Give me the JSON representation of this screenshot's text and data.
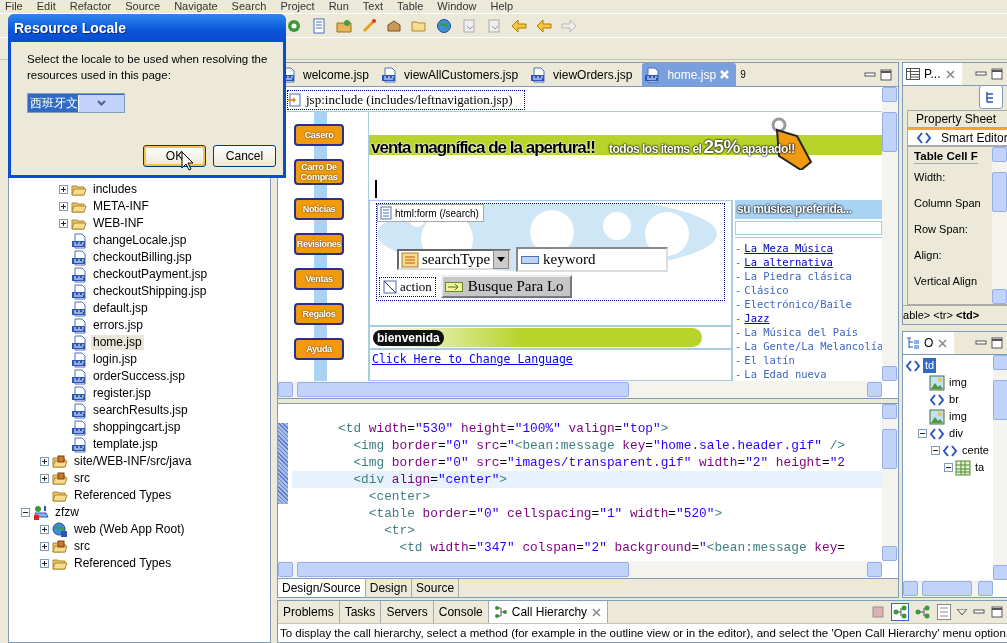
{
  "menu": [
    "File",
    "Edit",
    "Refactor",
    "Source",
    "Navigate",
    "Search",
    "Project",
    "Run",
    "Text",
    "Table",
    "Window",
    "Help"
  ],
  "dialog": {
    "title": "Resource Locale",
    "message": "Select the locale to be used when resolving the resources used in this page:",
    "locale": "西班牙文",
    "buttons": [
      {
        "label": "OK",
        "default": true
      },
      {
        "label": "Cancel",
        "default": false
      }
    ]
  },
  "explorer": {
    "tree": [
      {
        "children": [
          {
            "children": [
              {
                "label": "includes",
                "kind": "folder",
                "expanded": false,
                "selected": false
              },
              {
                "label": "META-INF",
                "kind": "folder",
                "expanded": false,
                "selected": false
              },
              {
                "label": "WEB-INF",
                "kind": "folder",
                "expanded": false,
                "selected": false
              },
              {
                "label": "changeLocale.jsp",
                "kind": "jsp",
                "selected": false
              },
              {
                "label": "checkoutBilling.jsp",
                "kind": "jsp",
                "selected": false
              },
              {
                "label": "checkoutPayment.jsp",
                "kind": "jsp",
                "selected": false
              },
              {
                "label": "checkoutShipping.jsp",
                "kind": "jsp",
                "selected": false
              },
              {
                "label": "default.jsp",
                "kind": "jsp",
                "selected": false
              },
              {
                "label": "errors.jsp",
                "kind": "jsp",
                "selected": false
              },
              {
                "label": "home.jsp",
                "kind": "jsp",
                "selected": true
              },
              {
                "label": "login.jsp",
                "kind": "jsp",
                "selected": false
              },
              {
                "label": "orderSuccess.jsp",
                "kind": "jsp",
                "selected": false
              },
              {
                "label": "register.jsp",
                "kind": "jsp",
                "selected": false
              },
              {
                "label": "searchResults.jsp",
                "kind": "jsp",
                "selected": false
              },
              {
                "label": "shoppingcart.jsp",
                "kind": "jsp",
                "selected": false
              },
              {
                "label": "template.jsp",
                "kind": "jsp",
                "selected": false
              }
            ]
          },
          {
            "label": "site/WEB-INF/src/java",
            "kind": "package",
            "expanded": false,
            "selected": false
          },
          {
            "label": "src",
            "kind": "package",
            "expanded": false,
            "selected": false
          },
          {
            "label": "Referenced Types",
            "kind": "folder",
            "selected": false
          }
        ]
      },
      {
        "label": "zfzw",
        "kind": "project",
        "expanded": true,
        "selected": false,
        "children": [
          {
            "label": "web (Web App Root)",
            "kind": "web",
            "expanded": false,
            "selected": false
          },
          {
            "label": "src",
            "kind": "package",
            "expanded": false,
            "selected": false
          },
          {
            "label": "Referenced Types",
            "kind": "folder",
            "expanded": false,
            "selected": false
          }
        ]
      }
    ]
  },
  "editor": {
    "tabs": [
      {
        "label": "welcome.jsp",
        "selected": false
      },
      {
        "label": "viewAllCustomers.jsp",
        "selected": false
      },
      {
        "label": "viewOrders.jsp",
        "selected": false
      },
      {
        "label": "home.jsp",
        "selected": true
      }
    ],
    "overflow_count": "9",
    "design": {
      "include_tag": "jsp:include (includes/leftnavigation.jsp)",
      "nav_buttons": [
        "Casero",
        "Carro De Compras",
        "Noticias",
        "Revisiones",
        "Ventas",
        "Regalos",
        "Ayuda"
      ],
      "banner": {
        "headline": "venta magnífica de la apertura!!",
        "promo": "todos los items el",
        "discount": "25%",
        "promo_end": "apagado!!"
      },
      "form": {
        "tag": "html:form (/search)",
        "select": "searchType",
        "input": "keyword",
        "action": "action",
        "submit": "Busque Para Lo"
      },
      "welcome": "bienvenida",
      "language_link": "Click Here to Change Language",
      "music": {
        "heading": "su música preferida...",
        "links": [
          {
            "bullet": "-",
            "label": "La Meza Música",
            "underlined": true
          },
          {
            "bullet": "-",
            "label": "La alternativa",
            "underlined": true
          },
          {
            "bullet": "-",
            "label": "La Piedra clásica",
            "underlined": false
          },
          {
            "bullet": "-",
            "label": "Clásico",
            "underlined": false
          },
          {
            "bullet": "-",
            "label": "Electrónico/Baile",
            "underlined": false
          },
          {
            "bullet": "-",
            "label": "Jazz",
            "underlined": true
          },
          {
            "bullet": "-",
            "label": "La Música del País",
            "underlined": false
          },
          {
            "bullet": "-",
            "label": "La Gente/La Melancolía",
            "underlined": false
          },
          {
            "bullet": "-",
            "label": "El latín",
            "underlined": false
          },
          {
            "bullet": "-",
            "label": "La Edad nueva",
            "underlined": false
          }
        ]
      }
    },
    "source": {
      "lines": [
        {
          "current": false,
          "tokens": [
            {
              "kind": "tag",
              "text": "      <td"
            },
            {
              "kind": "attr",
              "text": " width"
            },
            {
              "kind": "plain",
              "text": "="
            },
            {
              "kind": "val",
              "text": "\"530\""
            },
            {
              "kind": "attr",
              "text": " height"
            },
            {
              "kind": "plain",
              "text": "="
            },
            {
              "kind": "val",
              "text": "\"100%\""
            },
            {
              "kind": "attr",
              "text": " valign"
            },
            {
              "kind": "plain",
              "text": "="
            },
            {
              "kind": "val",
              "text": "\"top\""
            },
            {
              "kind": "tag",
              "text": ">"
            }
          ]
        },
        {
          "current": false,
          "tokens": [
            {
              "kind": "tag",
              "text": "        <img"
            },
            {
              "kind": "attr",
              "text": " border"
            },
            {
              "kind": "plain",
              "text": "="
            },
            {
              "kind": "val",
              "text": "\"0\""
            },
            {
              "kind": "attr",
              "text": " src"
            },
            {
              "kind": "plain",
              "text": "="
            },
            {
              "kind": "val",
              "text": "\""
            },
            {
              "kind": "tag",
              "text": "<bean:message"
            },
            {
              "kind": "attr",
              "text": " key"
            },
            {
              "kind": "plain",
              "text": "="
            },
            {
              "kind": "val",
              "text": "\"home.sale.header.gif\""
            },
            {
              "kind": "tag",
              "text": " />"
            }
          ]
        },
        {
          "current": false,
          "tokens": [
            {
              "kind": "tag",
              "text": "        <img"
            },
            {
              "kind": "attr",
              "text": " border"
            },
            {
              "kind": "plain",
              "text": "="
            },
            {
              "kind": "val",
              "text": "\"0\""
            },
            {
              "kind": "attr",
              "text": " src"
            },
            {
              "kind": "plain",
              "text": "="
            },
            {
              "kind": "val",
              "text": "\"images/transparent.gif\""
            },
            {
              "kind": "attr",
              "text": " width"
            },
            {
              "kind": "plain",
              "text": "="
            },
            {
              "kind": "val",
              "text": "\"2\""
            },
            {
              "kind": "attr",
              "text": " height"
            },
            {
              "kind": "plain",
              "text": "="
            },
            {
              "kind": "val",
              "text": "\"2"
            }
          ]
        },
        {
          "current": true,
          "tokens": [
            {
              "kind": "tag",
              "text": "        <div"
            },
            {
              "kind": "attr",
              "text": " align"
            },
            {
              "kind": "plain",
              "text": "="
            },
            {
              "kind": "val",
              "text": "\"center\""
            },
            {
              "kind": "tag",
              "text": ">"
            }
          ]
        },
        {
          "current": false,
          "tokens": [
            {
              "kind": "tag",
              "text": "          <center>"
            }
          ]
        },
        {
          "current": false,
          "tokens": [
            {
              "kind": "tag",
              "text": "          <table"
            },
            {
              "kind": "attr",
              "text": " border"
            },
            {
              "kind": "plain",
              "text": "="
            },
            {
              "kind": "val",
              "text": "\"0\""
            },
            {
              "kind": "attr",
              "text": " cellspacing"
            },
            {
              "kind": "plain",
              "text": "="
            },
            {
              "kind": "val",
              "text": "\"1\""
            },
            {
              "kind": "attr",
              "text": " width"
            },
            {
              "kind": "plain",
              "text": "="
            },
            {
              "kind": "val",
              "text": "\"520\""
            },
            {
              "kind": "tag",
              "text": ">"
            }
          ]
        },
        {
          "current": false,
          "tokens": [
            {
              "kind": "tag",
              "text": "            <tr>"
            }
          ]
        },
        {
          "current": false,
          "tokens": [
            {
              "kind": "tag",
              "text": "              <td"
            },
            {
              "kind": "attr",
              "text": " width"
            },
            {
              "kind": "plain",
              "text": "="
            },
            {
              "kind": "val",
              "text": "\"347\""
            },
            {
              "kind": "attr",
              "text": " colspan"
            },
            {
              "kind": "plain",
              "text": "="
            },
            {
              "kind": "val",
              "text": "\"2\""
            },
            {
              "kind": "attr",
              "text": " background"
            },
            {
              "kind": "plain",
              "text": "="
            },
            {
              "kind": "val",
              "text": "\""
            },
            {
              "kind": "tag",
              "text": "<bean:message"
            },
            {
              "kind": "attr",
              "text": " key"
            },
            {
              "kind": "plain",
              "text": "="
            }
          ]
        }
      ]
    },
    "mode_tabs": [
      {
        "label": "Design/Source",
        "selected": true
      },
      {
        "label": "Design",
        "selected": false
      },
      {
        "label": "Source",
        "selected": false
      }
    ]
  },
  "properties": {
    "title": "P...",
    "tabs": [
      {
        "label": "Property Sheet",
        "selected": false
      },
      {
        "label": "Smart Editor",
        "selected": true
      }
    ],
    "heading": "Table Cell F",
    "fields": [
      "Width:",
      "Column Span",
      "Row Span:",
      "Align:",
      "Vertical Align"
    ],
    "breadcrumb": "able> <tr> **<td>**"
  },
  "outline": {
    "title": "O",
    "tree": [
      {
        "label": "td",
        "kind": "tag",
        "selected": true,
        "children": [
          {
            "label": "img",
            "kind": "image",
            "selected": false
          },
          {
            "label": "br",
            "kind": "tag",
            "selected": false
          },
          {
            "label": "img",
            "kind": "image",
            "selected": false
          },
          {
            "label": "div",
            "kind": "tag",
            "expanded": true,
            "selected": false,
            "children": [
              {
                "label": "cente",
                "kind": "tag",
                "expanded": true,
                "selected": false,
                "children": [
                  {
                    "label": "ta",
                    "kind": "table",
                    "expanded": true,
                    "selected": false
                  }
                ]
              }
            ]
          }
        ]
      }
    ]
  },
  "bottom": {
    "tabs": [
      {
        "label": "Problems",
        "selected": false
      },
      {
        "label": "Tasks",
        "selected": false
      },
      {
        "label": "Servers",
        "selected": false
      },
      {
        "label": "Console",
        "selected": false
      },
      {
        "label": "Call Hierarchy",
        "selected": true
      }
    ],
    "message": "To display the call hierarchy, select a method (for example in the outline view or in the editor), and select the 'Open Call Hierarchy' menu option."
  }
}
